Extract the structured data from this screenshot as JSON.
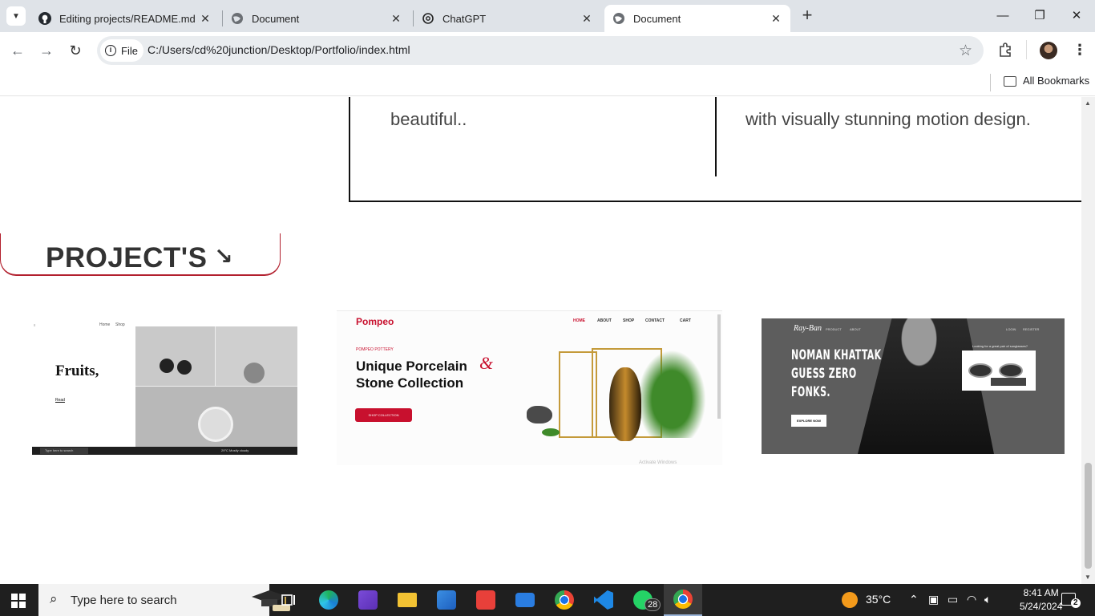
{
  "browser": {
    "tabs": [
      {
        "title": "Editing projects/README.md at",
        "icon": "github-icon"
      },
      {
        "title": "Document",
        "icon": "globe-icon"
      },
      {
        "title": "ChatGPT",
        "icon": "chatgpt-icon"
      },
      {
        "title": "Document",
        "icon": "globe-icon"
      }
    ],
    "active_tab_index": 3,
    "address": {
      "chip_label": "File",
      "url": "C:/Users/cd%20junction/Desktop/Portfolio/index.html"
    },
    "bookmarks": {
      "all_label": "All Bookmarks"
    }
  },
  "page": {
    "services": {
      "left_text": "beautiful..",
      "right_text": "with visually stunning motion design."
    },
    "projects": {
      "heading": "PROJECT'S",
      "arrow": "↘",
      "cards": [
        {
          "name": "fruits",
          "title": "Fruits,",
          "nav": [
            "Home",
            "Shop"
          ],
          "link": "Read",
          "taskbar_search": "Type here to search",
          "weather": "29°C Mostly cloudy"
        },
        {
          "name": "pompeo",
          "logo": "Pompeo",
          "nav": [
            "HOME",
            "ABOUT",
            "SHOP",
            "CONTACT",
            "CART"
          ],
          "eyebrow": "POMPEO POTTERY",
          "headline_1": "Unique Porcelain",
          "headline_2": "Stone Collection",
          "amp": "&",
          "button": "SHOP COLLECTION",
          "watermark": "Activate Windows"
        },
        {
          "name": "rayban",
          "brand": "Ray-Ban",
          "nav": [
            "PRODUCT",
            "ABOUT",
            "LOGIN",
            "REGISTER"
          ],
          "headline": [
            "NOMAN KHATTAK",
            "GUESS ZERO",
            "FONKS."
          ],
          "button": "EXPLORE NOW",
          "question": "Looking for a great pair of sunglasses?"
        }
      ]
    }
  },
  "taskbar": {
    "search_placeholder": "Type here to search",
    "whatsapp_badge": "28",
    "weather": "35°C",
    "time": "8:41 AM",
    "date": "5/24/2024",
    "notifications": "2"
  },
  "colors": {
    "accent_red": "#c8102e",
    "tabstrip": "#dfe3e8",
    "taskbar": "#1f1f1f"
  }
}
